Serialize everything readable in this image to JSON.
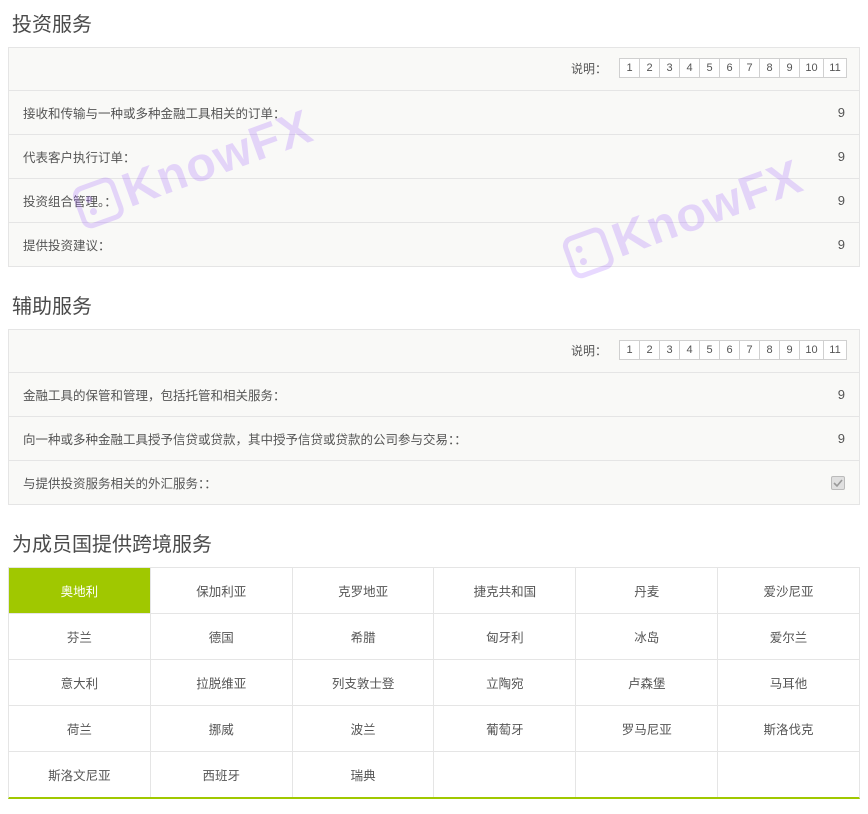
{
  "watermark": "KnowFX",
  "numbers": [
    "1",
    "2",
    "3",
    "4",
    "5",
    "6",
    "7",
    "8",
    "9",
    "10",
    "11"
  ],
  "sections": {
    "s1": {
      "title": "投资服务",
      "legend": "说明：",
      "rows": [
        {
          "label": "接收和传输与一种或多种金融工具相关的订单：",
          "value": "9"
        },
        {
          "label": "代表客户执行订单：",
          "value": "9"
        },
        {
          "label": "投资组合管理。：",
          "value": "9"
        },
        {
          "label": "提供投资建议：",
          "value": "9"
        }
      ]
    },
    "s2": {
      "title": "辅助服务",
      "legend": "说明：",
      "rows": [
        {
          "label": "金融工具的保管和管理，包括托管和相关服务：",
          "value": "9"
        },
        {
          "label": "向一种或多种金融工具授予信贷或贷款，其中授予信贷或贷款的公司参与交易：：",
          "value": "9"
        },
        {
          "label": "与提供投资服务相关的外汇服务：：",
          "value": "check"
        }
      ]
    },
    "s3": {
      "title": "为成员国提供跨境服务",
      "rows": [
        [
          "奥地利",
          "保加利亚",
          "克罗地亚",
          "捷克共和国",
          "丹麦",
          "爱沙尼亚"
        ],
        [
          "芬兰",
          "德国",
          "希腊",
          "匈牙利",
          "冰岛",
          "爱尔兰"
        ],
        [
          "意大利",
          "拉脱维亚",
          "列支敦士登",
          "立陶宛",
          "卢森堡",
          "马耳他"
        ],
        [
          "荷兰",
          "挪威",
          "波兰",
          "葡萄牙",
          "罗马尼亚",
          "斯洛伐克"
        ],
        [
          "斯洛文尼亚",
          "西班牙",
          "瑞典",
          "",
          "",
          ""
        ]
      ],
      "active": "奥地利"
    }
  }
}
